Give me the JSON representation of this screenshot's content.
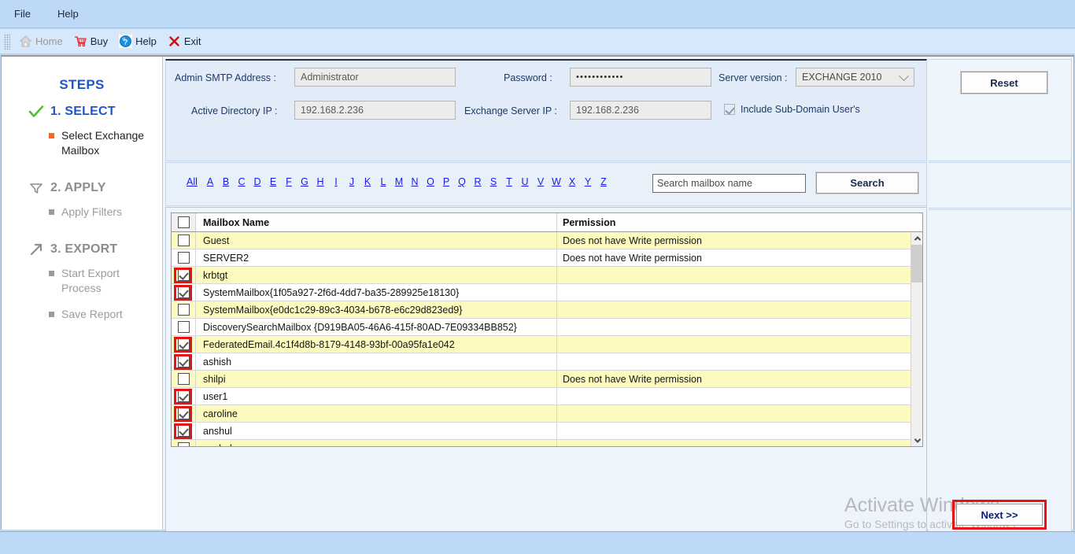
{
  "menubar": {
    "items": [
      {
        "label": "File",
        "name": "menu-file"
      },
      {
        "label": "Help",
        "name": "menu-help"
      }
    ]
  },
  "toolbar": {
    "items": [
      {
        "label": "Home",
        "icon": "home-icon",
        "disabled": true
      },
      {
        "label": "Buy",
        "icon": "cart-icon",
        "disabled": false
      },
      {
        "label": "Help",
        "icon": "help-info-icon",
        "disabled": false
      },
      {
        "label": "Exit",
        "icon": "close-x-icon",
        "disabled": false
      }
    ]
  },
  "sidebar": {
    "title": "STEPS",
    "steps": [
      {
        "label": "1. SELECT",
        "icon": "green-check-icon",
        "active": true,
        "substeps": [
          {
            "label": "Select Exchange Mailbox",
            "active": true
          }
        ]
      },
      {
        "label": "2. APPLY",
        "icon": "filter-icon",
        "active": false,
        "substeps": [
          {
            "label": "Apply Filters",
            "active": false
          }
        ]
      },
      {
        "label": "3. EXPORT",
        "icon": "arrow-up-right-icon",
        "active": false,
        "substeps": [
          {
            "label": "Start Export Process",
            "active": false
          },
          {
            "label": "Save Report",
            "active": false
          }
        ]
      }
    ]
  },
  "form": {
    "admin_smtp_label": "Admin SMTP Address :",
    "admin_smtp_value": "Administrator",
    "password_label": "Password :",
    "password_value": "••••••••••••",
    "server_version_label": "Server version :",
    "server_version_value": "EXCHANGE 2010",
    "ad_ip_label": "Active Directory IP :",
    "ad_ip_value": "192.168.2.236",
    "exchange_ip_label": "Exchange Server IP :",
    "exchange_ip_value": "192.168.2.236",
    "include_subdomain_label": "Include Sub-Domain User's",
    "include_subdomain_checked": true
  },
  "alpha_filter": {
    "all_label": "All",
    "letters": [
      "A",
      "B",
      "C",
      "D",
      "E",
      "F",
      "G",
      "H",
      "I",
      "J",
      "K",
      "L",
      "M",
      "N",
      "O",
      "P",
      "Q",
      "R",
      "S",
      "T",
      "U",
      "V",
      "W",
      "X",
      "Y",
      "Z"
    ]
  },
  "search": {
    "placeholder": "Search mailbox name",
    "value": "Search mailbox name",
    "button_label": "Search"
  },
  "grid": {
    "columns": [
      "Mailbox Name",
      "Permission"
    ],
    "header_checkbox_checked": false,
    "rows": [
      {
        "name": "Guest",
        "permission": "Does not have Write permission",
        "checked": false,
        "highlighted": false
      },
      {
        "name": "SERVER2",
        "permission": "Does not have Write permission",
        "checked": false,
        "highlighted": false
      },
      {
        "name": "krbtgt",
        "permission": "",
        "checked": true,
        "highlighted": true
      },
      {
        "name": "SystemMailbox{1f05a927-2f6d-4dd7-ba35-289925e18130}",
        "permission": "",
        "checked": true,
        "highlighted": true
      },
      {
        "name": "SystemMailbox{e0dc1c29-89c3-4034-b678-e6c29d823ed9}",
        "permission": "",
        "checked": false,
        "highlighted": false
      },
      {
        "name": "DiscoverySearchMailbox {D919BA05-46A6-415f-80AD-7E09334BB852}",
        "permission": "",
        "checked": false,
        "highlighted": false
      },
      {
        "name": "FederatedEmail.4c1f4d8b-8179-4148-93bf-00a95fa1e042",
        "permission": "",
        "checked": true,
        "highlighted": true
      },
      {
        "name": "ashish",
        "permission": "",
        "checked": true,
        "highlighted": true
      },
      {
        "name": "shilpi",
        "permission": "Does not have Write permission",
        "checked": false,
        "highlighted": false
      },
      {
        "name": "user1",
        "permission": "",
        "checked": true,
        "highlighted": true
      },
      {
        "name": "caroline",
        "permission": "",
        "checked": true,
        "highlighted": true
      },
      {
        "name": "anshul",
        "permission": "",
        "checked": true,
        "highlighted": true
      },
      {
        "name": "anchal",
        "permission": "",
        "checked": false,
        "highlighted": false
      }
    ]
  },
  "buttons": {
    "reset_label": "Reset",
    "next_label": "Next >>"
  },
  "watermark": {
    "line1": "Activate Windows",
    "line2": "Go to Settings to activate Windows."
  },
  "colors": {
    "accent_blue": "#1f56c4",
    "link_blue": "#1a1ae6",
    "row_alt": "#fcfabf",
    "highlight_red": "#e81212",
    "orange_bullet": "#f26a21",
    "title_bar": "#bed9f7"
  }
}
